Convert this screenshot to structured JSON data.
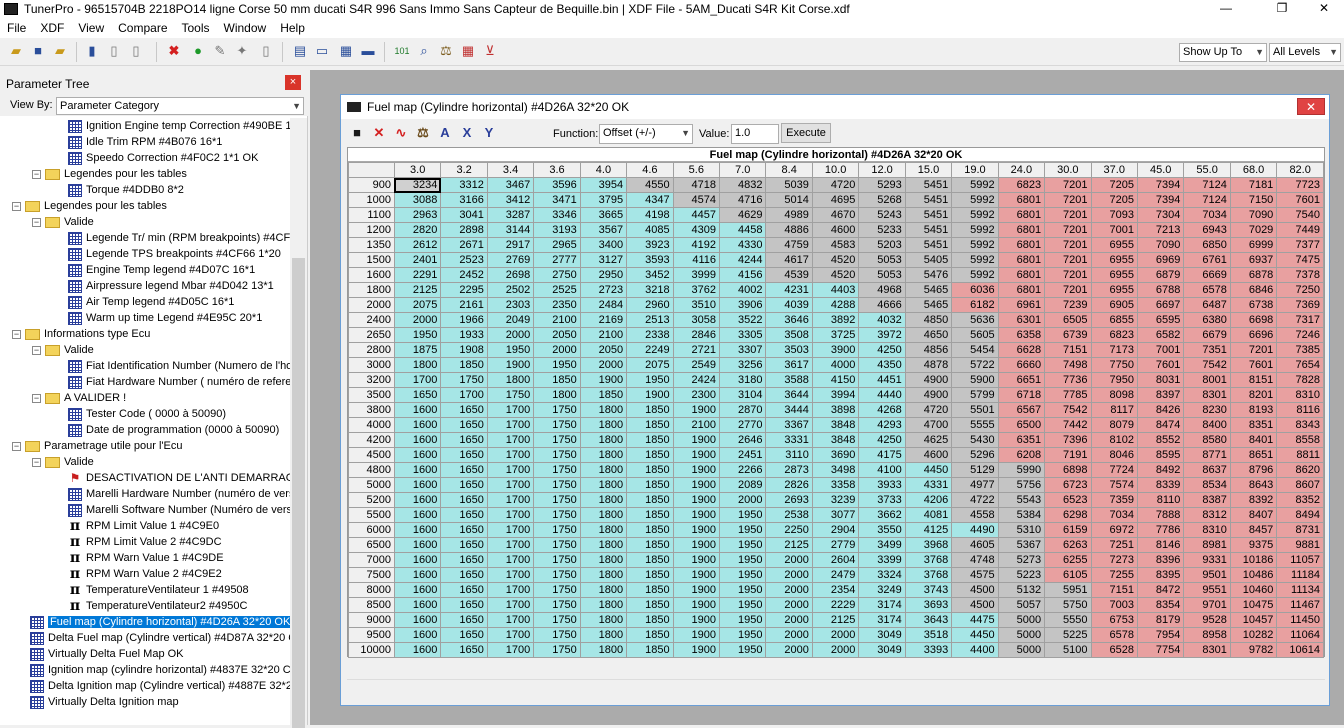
{
  "window": {
    "title": "TunerPro - 96515704B 2218PO14 ligne Corse 50 mm ducati S4R 996 Sans Immo Sans Capteur de Bequille.bin | XDF File - 5AM_Ducati S4R Kit Corse.xdf",
    "minimize": "—",
    "restore": "❐",
    "close": "✕"
  },
  "menu": [
    "File",
    "XDF",
    "View",
    "Compare",
    "Tools",
    "Window",
    "Help"
  ],
  "toolbar": {
    "show_up_to": "Show Up To",
    "levels": "All Levels"
  },
  "parameter_tree": {
    "title": "Parameter Tree",
    "close": "×",
    "view_by_label": "View By:",
    "view_by_value": "Parameter Category",
    "nodes": [
      {
        "label": "Ignition Engine temp Correction #490BE 1",
        "indent": 3,
        "icon": "table",
        "expander": ""
      },
      {
        "label": "Idle Trim RPM  #4B076 16*1",
        "indent": 3,
        "icon": "table",
        "expander": ""
      },
      {
        "label": "Speedo Correction #4F0C2 1*1 OK",
        "indent": 3,
        "icon": "table",
        "expander": ""
      },
      {
        "label": "Legendes pour les tables",
        "indent": 1,
        "icon": "folder",
        "expander": "−"
      },
      {
        "label": "Torque #4DDB0 8*2",
        "indent": 2,
        "icon": "table",
        "expander": ""
      },
      {
        "label": "Legendes pour les tables",
        "indent": 0,
        "icon": "folder",
        "expander": "−"
      },
      {
        "label": "Valide",
        "indent": 1,
        "icon": "folder",
        "expander": "−"
      },
      {
        "label": "Legende Tr/ min  (RPM breakpoints) #4CF",
        "indent": 2,
        "icon": "table",
        "expander": ""
      },
      {
        "label": "Legende TPS breakpoints #4CF66 1*20",
        "indent": 2,
        "icon": "table",
        "expander": ""
      },
      {
        "label": "Engine Temp  legend #4D07C 16*1",
        "indent": 2,
        "icon": "table",
        "expander": ""
      },
      {
        "label": "Airpressure legend Mbar  #4D042 13*1",
        "indent": 2,
        "icon": "table",
        "expander": ""
      },
      {
        "label": "Air Temp legend #4D05C 16*1",
        "indent": 2,
        "icon": "table",
        "expander": ""
      },
      {
        "label": "Warm up time Legend #4E95C 20*1",
        "indent": 2,
        "icon": "table",
        "expander": ""
      },
      {
        "label": "Informations  type Ecu",
        "indent": 0,
        "icon": "folder",
        "expander": "−"
      },
      {
        "label": "Valide",
        "indent": 1,
        "icon": "folder",
        "expander": "−"
      },
      {
        "label": "Fiat Identification Number (Numero de l'ho",
        "indent": 2,
        "icon": "table",
        "expander": ""
      },
      {
        "label": "Fiat Hardware Number ( numéro de refere",
        "indent": 2,
        "icon": "table",
        "expander": ""
      },
      {
        "label": "A VALIDER !",
        "indent": 1,
        "icon": "folder",
        "expander": "−"
      },
      {
        "label": "Tester Code ( 0000 à 50090)",
        "indent": 2,
        "icon": "table",
        "expander": ""
      },
      {
        "label": "Date de programmation (0000 à 50090)",
        "indent": 2,
        "icon": "table",
        "expander": ""
      },
      {
        "label": "Parametrage utile pour l'Ecu",
        "indent": 0,
        "icon": "folder",
        "expander": "−"
      },
      {
        "label": "Valide",
        "indent": 1,
        "icon": "folder",
        "expander": "−"
      },
      {
        "label": "DESACTIVATION DE L'ANTI DEMARRAGE",
        "indent": 2,
        "icon": "flag",
        "expander": ""
      },
      {
        "label": "Marelli Hardware Number (numéro de vers",
        "indent": 2,
        "icon": "table",
        "expander": ""
      },
      {
        "label": "Marelli Software Number (Numéro de versi",
        "indent": 2,
        "icon": "table",
        "expander": ""
      },
      {
        "label": "RPM Limit  Value 1 #4C9E0",
        "indent": 2,
        "icon": "pi",
        "expander": ""
      },
      {
        "label": "RPM Limit Value 2 #4C9DC",
        "indent": 2,
        "icon": "pi",
        "expander": ""
      },
      {
        "label": "RPM Warn Value 1 #4C9DE",
        "indent": 2,
        "icon": "pi",
        "expander": ""
      },
      {
        "label": "RPM Warn  Value 2 #4C9E2",
        "indent": 2,
        "icon": "pi",
        "expander": ""
      },
      {
        "label": "TemperatureVentilateur 1 #49508",
        "indent": 2,
        "icon": "pi",
        "expander": ""
      },
      {
        "label": "TemperatureVentilateur2 #4950C",
        "indent": 2,
        "icon": "pi",
        "expander": ""
      },
      {
        "label": "Fuel map (Cylindre horizontal) #4D26A 32*20 OK",
        "indent": -1,
        "icon": "table",
        "expander": "",
        "selected": true
      },
      {
        "label": "Delta Fuel map (Cylindre vertical) #4D87A 32*20 C",
        "indent": -1,
        "icon": "table",
        "expander": ""
      },
      {
        "label": "Virtually  Delta Fuel Map OK",
        "indent": -1,
        "icon": "table",
        "expander": ""
      },
      {
        "label": "Ignition map (cylindre horizontal) #4837E 32*20 C",
        "indent": -1,
        "icon": "table",
        "expander": ""
      },
      {
        "label": "Delta Ignition map (Cylindre vertical) #4887E 32*2",
        "indent": -1,
        "icon": "table",
        "expander": ""
      },
      {
        "label": "Virtually Delta Ignition map",
        "indent": -1,
        "icon": "table",
        "expander": ""
      }
    ]
  },
  "editor": {
    "title": "Fuel map (Cylindre horizontal) #4D26A 32*20 OK",
    "close": "✕",
    "function_label": "Function:",
    "function_value": "Offset (+/-)",
    "value_label": "Value:",
    "value": "1.0",
    "execute": "Execute",
    "grid_title": "Fuel map (Cylindre horizontal) #4D26A 32*20 OK",
    "colors": {
      "low": "#a6e6e6",
      "mid": "#c4c4c4",
      "high": "#e8a0a0"
    },
    "cols": [
      "3.0",
      "3.2",
      "3.4",
      "3.6",
      "4.0",
      "4.6",
      "5.6",
      "7.0",
      "8.4",
      "10.0",
      "12.0",
      "15.0",
      "19.0",
      "24.0",
      "30.0",
      "37.0",
      "45.0",
      "55.0",
      "68.0",
      "82.0"
    ],
    "rows": [
      {
        "rpm": "900",
        "v": [
          3234,
          3312,
          3467,
          3596,
          3954,
          4550,
          4718,
          4832,
          5039,
          4720,
          5293,
          5451,
          5992,
          6823,
          7201,
          7205,
          7394,
          7124,
          7181,
          7723
        ]
      },
      {
        "rpm": "1000",
        "v": [
          3088,
          3166,
          3412,
          3471,
          3795,
          4347,
          4574,
          4716,
          5014,
          4695,
          5268,
          5451,
          5992,
          6801,
          7201,
          7205,
          7394,
          7124,
          7150,
          7601
        ]
      },
      {
        "rpm": "1100",
        "v": [
          2963,
          3041,
          3287,
          3346,
          3665,
          4198,
          4457,
          4629,
          4989,
          4670,
          5243,
          5451,
          5992,
          6801,
          7201,
          7093,
          7304,
          7034,
          7090,
          7540
        ]
      },
      {
        "rpm": "1200",
        "v": [
          2820,
          2898,
          3144,
          3193,
          3567,
          4085,
          4309,
          4458,
          4886,
          4600,
          5233,
          5451,
          5992,
          6801,
          7201,
          7001,
          7213,
          6943,
          7029,
          7449
        ]
      },
      {
        "rpm": "1350",
        "v": [
          2612,
          2671,
          2917,
          2965,
          3400,
          3923,
          4192,
          4330,
          4759,
          4583,
          5203,
          5451,
          5992,
          6801,
          7201,
          6955,
          7090,
          6850,
          6999,
          7377
        ]
      },
      {
        "rpm": "1500",
        "v": [
          2401,
          2523,
          2769,
          2777,
          3127,
          3593,
          4116,
          4244,
          4617,
          4520,
          5053,
          5405,
          5992,
          6801,
          7201,
          6955,
          6969,
          6761,
          6937,
          7475
        ]
      },
      {
        "rpm": "1600",
        "v": [
          2291,
          2452,
          2698,
          2750,
          2950,
          3452,
          3999,
          4156,
          4539,
          4520,
          5053,
          5476,
          5992,
          6801,
          7201,
          6955,
          6879,
          6669,
          6878,
          7378
        ]
      },
      {
        "rpm": "1800",
        "v": [
          2125,
          2295,
          2502,
          2525,
          2723,
          3218,
          3762,
          4002,
          4231,
          4403,
          4968,
          5465,
          6036,
          6801,
          7201,
          6955,
          6788,
          6578,
          6846,
          7250
        ]
      },
      {
        "rpm": "2000",
        "v": [
          2075,
          2161,
          2303,
          2350,
          2484,
          2960,
          3510,
          3906,
          4039,
          4288,
          4666,
          5465,
          6182,
          6961,
          7239,
          6905,
          6697,
          6487,
          6738,
          7369
        ]
      },
      {
        "rpm": "2400",
        "v": [
          2000,
          1966,
          2049,
          2100,
          2169,
          2513,
          3058,
          3522,
          3646,
          3892,
          4032,
          4850,
          5636,
          6301,
          6505,
          6855,
          6595,
          6380,
          6698,
          7317
        ]
      },
      {
        "rpm": "2650",
        "v": [
          1950,
          1933,
          2000,
          2050,
          2100,
          2338,
          2846,
          3305,
          3508,
          3725,
          3972,
          4650,
          5605,
          6358,
          6739,
          6823,
          6582,
          6679,
          6696,
          7246
        ]
      },
      {
        "rpm": "2800",
        "v": [
          1875,
          1908,
          1950,
          2000,
          2050,
          2249,
          2721,
          3307,
          3503,
          3900,
          4250,
          4856,
          5454,
          6628,
          7151,
          7173,
          7001,
          7351,
          7201,
          7385
        ]
      },
      {
        "rpm": "3000",
        "v": [
          1800,
          1850,
          1900,
          1950,
          2000,
          2075,
          2549,
          3256,
          3617,
          4000,
          4350,
          4878,
          5722,
          6660,
          7498,
          7750,
          7601,
          7542,
          7601,
          7654
        ]
      },
      {
        "rpm": "3200",
        "v": [
          1700,
          1750,
          1800,
          1850,
          1900,
          1950,
          2424,
          3180,
          3588,
          4150,
          4451,
          4900,
          5900,
          6651,
          7736,
          7950,
          8031,
          8001,
          8151,
          7828
        ]
      },
      {
        "rpm": "3500",
        "v": [
          1650,
          1700,
          1750,
          1800,
          1850,
          1900,
          2300,
          3104,
          3644,
          3994,
          4440,
          4900,
          5799,
          6718,
          7785,
          8098,
          8397,
          8301,
          8201,
          8310
        ]
      },
      {
        "rpm": "3800",
        "v": [
          1600,
          1650,
          1700,
          1750,
          1800,
          1850,
          1900,
          2870,
          3444,
          3898,
          4268,
          4720,
          5501,
          6567,
          7542,
          8117,
          8426,
          8230,
          8193,
          8116
        ]
      },
      {
        "rpm": "4000",
        "v": [
          1600,
          1650,
          1700,
          1750,
          1800,
          1850,
          2100,
          2770,
          3367,
          3848,
          4293,
          4700,
          5555,
          6500,
          7442,
          8079,
          8474,
          8400,
          8351,
          8343
        ]
      },
      {
        "rpm": "4200",
        "v": [
          1600,
          1650,
          1700,
          1750,
          1800,
          1850,
          1900,
          2646,
          3331,
          3848,
          4250,
          4625,
          5430,
          6351,
          7396,
          8102,
          8552,
          8580,
          8401,
          8558
        ]
      },
      {
        "rpm": "4500",
        "v": [
          1600,
          1650,
          1700,
          1750,
          1800,
          1850,
          1900,
          2451,
          3110,
          3690,
          4175,
          4600,
          5296,
          6208,
          7191,
          8046,
          8595,
          8771,
          8651,
          8811
        ]
      },
      {
        "rpm": "4800",
        "v": [
          1600,
          1650,
          1700,
          1750,
          1800,
          1850,
          1900,
          2266,
          2873,
          3498,
          4100,
          4450,
          5129,
          5990,
          6898,
          7724,
          8492,
          8637,
          8796,
          8620
        ]
      },
      {
        "rpm": "5000",
        "v": [
          1600,
          1650,
          1700,
          1750,
          1800,
          1850,
          1900,
          2089,
          2826,
          3358,
          3933,
          4331,
          4977,
          5756,
          6723,
          7574,
          8339,
          8534,
          8643,
          8607
        ]
      },
      {
        "rpm": "5200",
        "v": [
          1600,
          1650,
          1700,
          1750,
          1800,
          1850,
          1900,
          2000,
          2693,
          3239,
          3733,
          4206,
          4722,
          5543,
          6523,
          7359,
          8110,
          8387,
          8392,
          8352
        ]
      },
      {
        "rpm": "5500",
        "v": [
          1600,
          1650,
          1700,
          1750,
          1800,
          1850,
          1900,
          1950,
          2538,
          3077,
          3662,
          4081,
          4558,
          5384,
          6298,
          7034,
          7888,
          8312,
          8407,
          8494
        ]
      },
      {
        "rpm": "6000",
        "v": [
          1600,
          1650,
          1700,
          1750,
          1800,
          1850,
          1900,
          1950,
          2250,
          2904,
          3550,
          4125,
          4490,
          5310,
          6159,
          6972,
          7786,
          8310,
          8457,
          8731
        ]
      },
      {
        "rpm": "6500",
        "v": [
          1600,
          1650,
          1700,
          1750,
          1800,
          1850,
          1900,
          1950,
          2125,
          2779,
          3499,
          3968,
          4605,
          5367,
          6263,
          7251,
          8146,
          8981,
          9375,
          9881
        ]
      },
      {
        "rpm": "7000",
        "v": [
          1600,
          1650,
          1700,
          1750,
          1800,
          1850,
          1900,
          1950,
          2000,
          2604,
          3399,
          3768,
          4748,
          5273,
          6255,
          7273,
          8396,
          9331,
          10186,
          11057
        ]
      },
      {
        "rpm": "7500",
        "v": [
          1600,
          1650,
          1700,
          1750,
          1800,
          1850,
          1900,
          1950,
          2000,
          2479,
          3324,
          3768,
          4575,
          5223,
          6105,
          7255,
          8395,
          9501,
          10486,
          11184
        ]
      },
      {
        "rpm": "8000",
        "v": [
          1600,
          1650,
          1700,
          1750,
          1800,
          1850,
          1900,
          1950,
          2000,
          2354,
          3249,
          3743,
          4500,
          5132,
          5951,
          7151,
          8472,
          9551,
          10460,
          11134
        ]
      },
      {
        "rpm": "8500",
        "v": [
          1600,
          1650,
          1700,
          1750,
          1800,
          1850,
          1900,
          1950,
          2000,
          2229,
          3174,
          3693,
          4500,
          5057,
          5750,
          7003,
          8354,
          9701,
          10475,
          11467
        ]
      },
      {
        "rpm": "9000",
        "v": [
          1600,
          1650,
          1700,
          1750,
          1800,
          1850,
          1900,
          1950,
          2000,
          2125,
          3174,
          3643,
          4475,
          5000,
          5550,
          6753,
          8179,
          9528,
          10457,
          11450
        ]
      },
      {
        "rpm": "9500",
        "v": [
          1600,
          1650,
          1700,
          1750,
          1800,
          1850,
          1900,
          1950,
          2000,
          2000,
          3049,
          3518,
          4450,
          5000,
          5225,
          6578,
          7954,
          8958,
          10282,
          11064
        ]
      },
      {
        "rpm": "10000",
        "v": [
          1600,
          1650,
          1700,
          1750,
          1800,
          1850,
          1900,
          1950,
          2000,
          2000,
          3049,
          3393,
          4400,
          5000,
          5100,
          6528,
          7754,
          8301,
          9782,
          10614
        ]
      }
    ]
  }
}
